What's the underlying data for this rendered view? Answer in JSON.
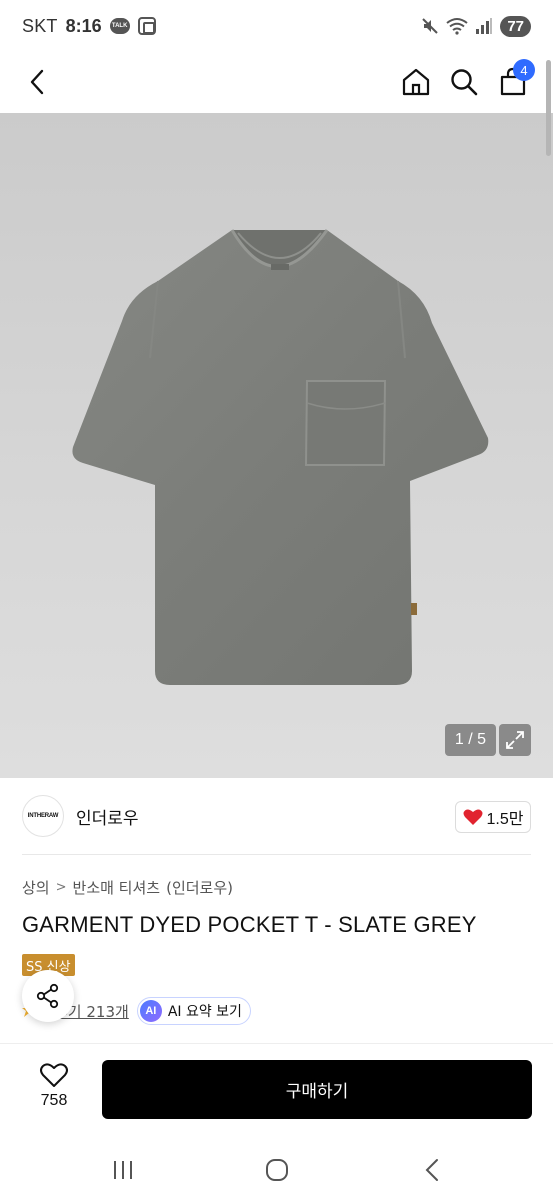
{
  "status_bar": {
    "carrier": "SKT",
    "time": "8:16",
    "talk_icon_text": "TALK",
    "battery": "77",
    "icons": [
      "talk-icon",
      "screen-record-icon",
      "mute-icon",
      "wifi-icon",
      "signal-icon",
      "battery-icon"
    ]
  },
  "nav": {
    "icons": [
      "back-icon",
      "home-icon",
      "search-icon",
      "cart-icon"
    ],
    "cart_badge": "4"
  },
  "image_viewer": {
    "counter": "1 / 5",
    "current": 1,
    "total": 5
  },
  "brand": {
    "logo_text": "INTHERAW",
    "name": "인더로우",
    "likes": "1.5만"
  },
  "product": {
    "breadcrumb": [
      "상의",
      "반소매 티셔츠",
      "(인더로우)"
    ],
    "title": "GARMENT DYED POCKET T - SLATE GREY",
    "season_badge": "SS 신상",
    "reviews": "후기 213개",
    "ai_label": "AI",
    "ai_summary": "AI 요약 보기"
  },
  "bottom_bar": {
    "wish_count": "758",
    "buy_label": "구매하기"
  },
  "colors": {
    "accent_blue": "#2f6bff",
    "badge_gold": "#c88e2e",
    "heart_red": "#e1232f",
    "buy_button": "#000000",
    "shirt": "#7b7d79"
  }
}
